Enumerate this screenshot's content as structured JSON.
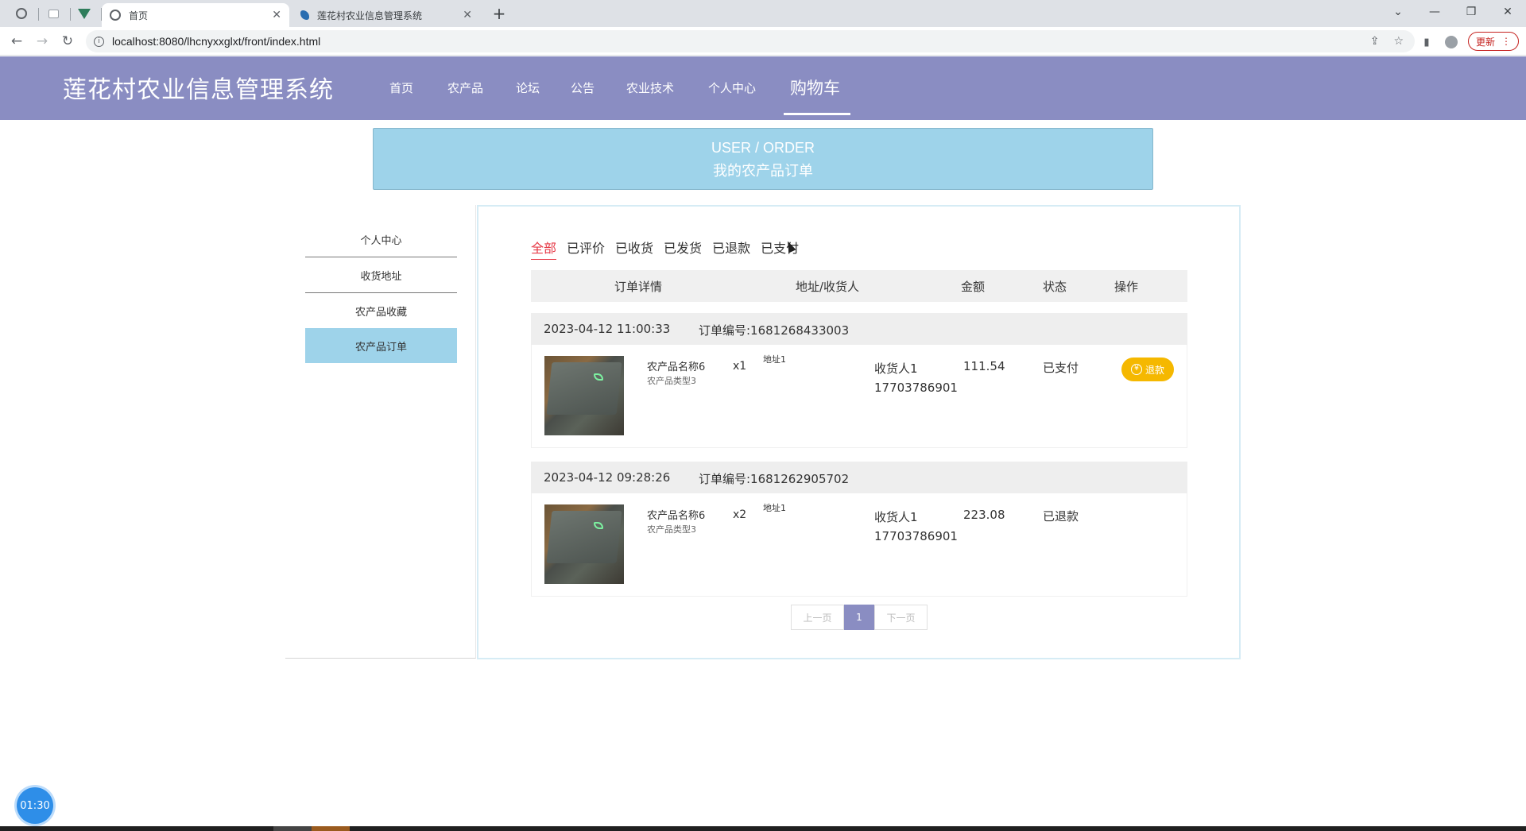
{
  "browser": {
    "tabs": [
      {
        "title": "首页",
        "active": true
      },
      {
        "title": "莲花村农业信息管理系统",
        "active": false
      }
    ],
    "url": "localhost:8080/lhcnyxxglxt/front/index.html",
    "update_label": "更新"
  },
  "site": {
    "title": "莲花村农业信息管理系统",
    "nav": [
      "首页",
      "农产品",
      "论坛",
      "公告",
      "农业技术",
      "个人中心",
      "购物车"
    ],
    "active_nav": "购物车"
  },
  "banner": {
    "en": "USER / ORDER",
    "cn": "我的农产品订单"
  },
  "sidebar": {
    "items": [
      "个人中心",
      "收货地址",
      "农产品收藏",
      "农产品订单"
    ],
    "active": "农产品订单"
  },
  "filters": {
    "items": [
      "全部",
      "已评价",
      "已收货",
      "已发货",
      "已退款",
      "已支付"
    ],
    "active": "全部"
  },
  "table": {
    "headers": [
      "订单详情",
      "地址/收货人",
      "金额",
      "状态",
      "操作"
    ]
  },
  "orders": [
    {
      "time": "2023-04-12 11:00:33",
      "order_no": "订单编号:1681268433003",
      "product_name": "农产品名称6",
      "product_type": "农产品类型3",
      "qty": "x1",
      "address": "地址1",
      "receiver": "收货人1",
      "phone": "17703786901",
      "amount": "111.54",
      "status": "已支付",
      "action": "退款"
    },
    {
      "time": "2023-04-12 09:28:26",
      "order_no": "订单编号:1681262905702",
      "product_name": "农产品名称6",
      "product_type": "农产品类型3",
      "qty": "x2",
      "address": "地址1",
      "receiver": "收货人1",
      "phone": "17703786901",
      "amount": "223.08",
      "status": "已退款",
      "action": ""
    }
  ],
  "pager": {
    "prev": "上一页",
    "current": "1",
    "next": "下一页"
  },
  "timer": "01:30",
  "colors": {
    "header": "#8a8dc2",
    "banner": "#9ed3ea",
    "active_filter": "#e63946",
    "refund_button": "#f5b800"
  }
}
